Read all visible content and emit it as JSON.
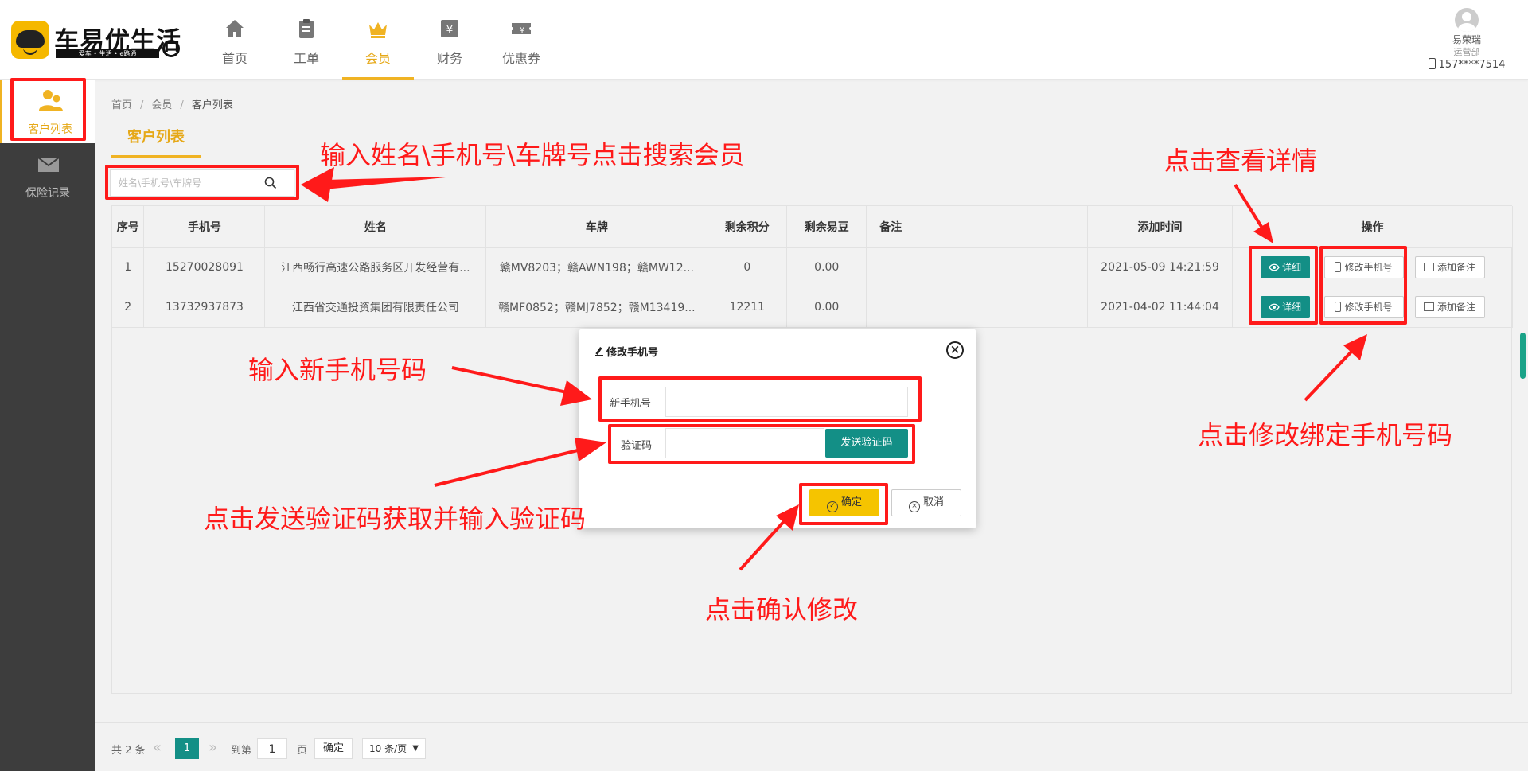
{
  "brand": {
    "name": "车易优生活",
    "tagline": "爱车 • 生活 • e路通"
  },
  "topnav": [
    {
      "label": "首页",
      "icon": "home-icon"
    },
    {
      "label": "工单",
      "icon": "clipboard-icon"
    },
    {
      "label": "会员",
      "icon": "crown-icon",
      "active": true
    },
    {
      "label": "财务",
      "icon": "yen-icon"
    },
    {
      "label": "优惠券",
      "icon": "coupon-icon"
    }
  ],
  "user": {
    "name": "易荣瑞",
    "dept": "运营部",
    "phone": "157****7514"
  },
  "sidebar": [
    {
      "label": "客户列表",
      "icon": "users-icon",
      "active": true
    },
    {
      "label": "保险记录",
      "icon": "mail-icon"
    }
  ],
  "breadcrumb": {
    "home": "首页",
    "section": "会员",
    "current": "客户列表"
  },
  "page_tab": "客户列表",
  "search": {
    "placeholder": "姓名\\手机号\\车牌号",
    "value": ""
  },
  "table": {
    "headers": [
      "序号",
      "手机号",
      "姓名",
      "车牌",
      "剩余积分",
      "剩余易豆",
      "备注",
      "添加时间",
      "操作"
    ],
    "rows": [
      {
        "idx": "1",
        "phone": "15270028091",
        "name": "江西畅行高速公路服务区开发经营有...",
        "plates": "赣MV8203；赣AWN198；赣MW12...",
        "points": "0",
        "beans": "0.00",
        "note": "",
        "time": "2021-05-09 14:21:59"
      },
      {
        "idx": "2",
        "phone": "13732937873",
        "name": "江西省交通投资集团有限责任公司",
        "plates": "赣MF0852；赣MJ7852；赣M13419...",
        "points": "12211",
        "beans": "0.00",
        "note": "",
        "time": "2021-04-02 11:44:04"
      }
    ],
    "ops": {
      "detail": "详细",
      "edit_phone": "修改手机号",
      "add_note": "添加备注"
    }
  },
  "pagination": {
    "total": "共 2 条",
    "prev": "«",
    "current": "1",
    "next": "»",
    "goto_label": "到第",
    "goto_value": "1",
    "unit": "页",
    "confirm": "确定",
    "size": "10 条/页"
  },
  "modal": {
    "title": "修改手机号",
    "new_phone_label": "新手机号",
    "new_phone_value": "",
    "code_label": "验证码",
    "code_value": "",
    "send_code": "发送验证码",
    "confirm": "确定",
    "cancel": "取消"
  },
  "annotations": {
    "search": "输入姓名\\手机号\\车牌号点击搜索会员",
    "detail": "点击查看详情",
    "new_phone": "输入新手机号码",
    "edit_phone": "点击修改绑定手机号码",
    "send_code": "点击发送验证码获取并输入验证码",
    "confirm": "点击确认修改"
  },
  "colors": {
    "accent": "#f0b323",
    "teal": "#138f86",
    "annotation": "#ff1a1a",
    "sidebar": "#3d3d3d"
  }
}
